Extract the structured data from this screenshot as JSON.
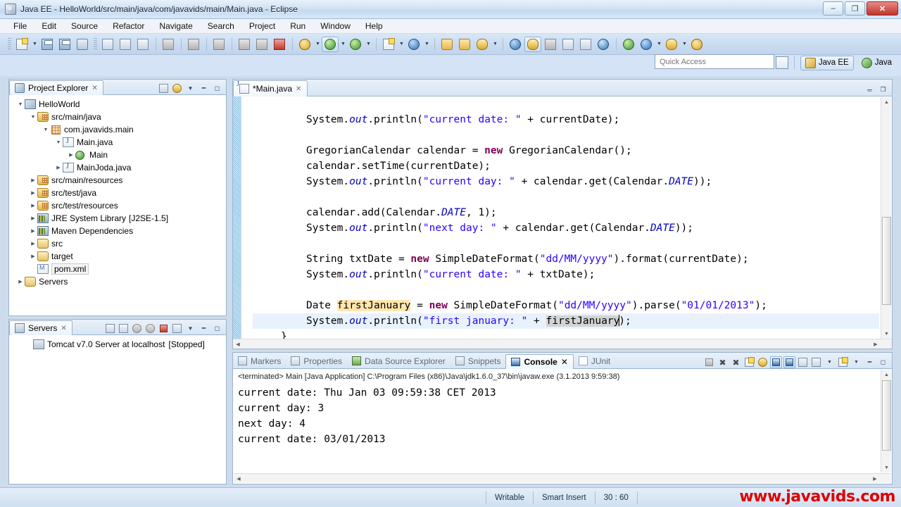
{
  "window": {
    "title": "Java EE - HelloWorld/src/main/java/com/javavids/main/Main.java - Eclipse",
    "minimize_label": "–",
    "maximize_label": "❐",
    "close_label": "✕"
  },
  "menu": {
    "items": [
      "File",
      "Edit",
      "Source",
      "Refactor",
      "Navigate",
      "Search",
      "Project",
      "Run",
      "Window",
      "Help"
    ]
  },
  "toolbar": {
    "icons": [
      "new-wizard-icon",
      "new-dropdown-icon",
      "save-icon",
      "save-all-icon",
      "print-icon",
      "toggle-breadcrumb-icon",
      "next-annotation-icon",
      "previous-annotation-icon",
      "undo-icon",
      "redo-icon",
      "back-icon",
      "step-into-icon",
      "step-over-icon",
      "terminate-icon",
      "debug-icon",
      "debug-dropdown-icon",
      "run-icon",
      "run-dropdown-icon",
      "run-external-icon",
      "run-external-dropdown-icon",
      "new-java-project-icon",
      "new-java-dropdown-icon",
      "search-icon",
      "search-dropdown-icon",
      "open-type-icon",
      "open-resource-icon",
      "new-annotation-icon",
      "new-annotation-dropdown-icon",
      "refresh-icon",
      "java-editor-icon",
      "skip-breakpoints-icon",
      "open-task-icon",
      "pilcrow-icon",
      "web-browser-icon",
      "run-server-icon",
      "import-icon",
      "import-dropdown-icon",
      "export-icon",
      "export-dropdown-icon",
      "more-icon"
    ]
  },
  "quick_access": {
    "placeholder": "Quick Access"
  },
  "perspectives": {
    "new_perspective_tooltip": "Open Perspective",
    "items": [
      {
        "label": "Java EE",
        "active": true
      },
      {
        "label": "Java",
        "active": false
      }
    ]
  },
  "project_explorer": {
    "tab_label": "Project Explorer",
    "close_label": "✕",
    "toolbar_icons": [
      "collapse-all-icon",
      "link-with-editor-icon",
      "view-menu-icon",
      "minimize-icon",
      "maximize-icon"
    ],
    "tree": [
      {
        "label": "HelloWorld",
        "indent": 0,
        "twisty": "open",
        "icon": "project-icon",
        "suffix": ""
      },
      {
        "label": "src/main/java",
        "indent": 1,
        "twisty": "open",
        "icon": "source-folder-icon",
        "suffix": ""
      },
      {
        "label": "com.javavids.main",
        "indent": 2,
        "twisty": "open",
        "icon": "package-icon",
        "suffix": ""
      },
      {
        "label": "Main.java",
        "indent": 3,
        "twisty": "open",
        "icon": "java-file-icon",
        "suffix": ""
      },
      {
        "label": "Main",
        "indent": 4,
        "twisty": "closed",
        "icon": "class-icon",
        "suffix": ""
      },
      {
        "label": "MainJoda.java",
        "indent": 3,
        "twisty": "closed",
        "icon": "java-file-icon",
        "suffix": ""
      },
      {
        "label": "src/main/resources",
        "indent": 1,
        "twisty": "closed",
        "icon": "source-folder-icon",
        "suffix": ""
      },
      {
        "label": "src/test/java",
        "indent": 1,
        "twisty": "closed",
        "icon": "source-folder-icon",
        "suffix": ""
      },
      {
        "label": "src/test/resources",
        "indent": 1,
        "twisty": "closed",
        "icon": "source-folder-icon",
        "suffix": ""
      },
      {
        "label": "JRE System Library",
        "indent": 1,
        "twisty": "closed",
        "icon": "library-icon",
        "suffix": "[J2SE-1.5]"
      },
      {
        "label": "Maven Dependencies",
        "indent": 1,
        "twisty": "closed",
        "icon": "library-icon",
        "suffix": ""
      },
      {
        "label": "src",
        "indent": 1,
        "twisty": "closed",
        "icon": "folder-icon",
        "suffix": ""
      },
      {
        "label": "target",
        "indent": 1,
        "twisty": "closed",
        "icon": "folder-icon",
        "suffix": ""
      },
      {
        "label": "pom.xml",
        "indent": 1,
        "twisty": "none",
        "icon": "pom-file-icon",
        "suffix": "",
        "selected": true
      },
      {
        "label": "Servers",
        "indent": 0,
        "twisty": "closed",
        "icon": "folder-icon",
        "suffix": ""
      }
    ]
  },
  "servers_view": {
    "tab_label": "Servers",
    "close_label": "✕",
    "toolbar_icons": [
      "collapse-all-icon",
      "debug-server-icon",
      "start-server-icon",
      "profile-server-icon",
      "stop-server-icon",
      "publish-icon",
      "view-menu-icon",
      "minimize-icon",
      "maximize-icon"
    ],
    "rows": [
      {
        "label": "Tomcat v7.0 Server at localhost",
        "status": "[Stopped]"
      }
    ]
  },
  "editor": {
    "tab_label": "*Main.java",
    "close_label": "✕",
    "minimize_label": "═",
    "maximize_label": "❐",
    "lines": [
      {
        "type": "blank"
      },
      {
        "segments": [
          {
            "t": "System."
          },
          {
            "t": "out",
            "c": "fld"
          },
          {
            "t": ".println("
          },
          {
            "t": "\"current date: \"",
            "c": "str"
          },
          {
            "t": " + currentDate);"
          }
        ]
      },
      {
        "type": "blank"
      },
      {
        "segments": [
          {
            "t": "GregorianCalendar calendar = "
          },
          {
            "t": "new",
            "c": "kw"
          },
          {
            "t": " GregorianCalendar();"
          }
        ]
      },
      {
        "segments": [
          {
            "t": "calendar.setTime(currentDate);"
          }
        ]
      },
      {
        "segments": [
          {
            "t": "System."
          },
          {
            "t": "out",
            "c": "fld"
          },
          {
            "t": ".println("
          },
          {
            "t": "\"current day: \"",
            "c": "str"
          },
          {
            "t": " + calendar.get(Calendar."
          },
          {
            "t": "DATE",
            "c": "fld"
          },
          {
            "t": "));"
          }
        ]
      },
      {
        "type": "blank"
      },
      {
        "segments": [
          {
            "t": "calendar.add(Calendar."
          },
          {
            "t": "DATE",
            "c": "fld"
          },
          {
            "t": ", 1);"
          }
        ]
      },
      {
        "segments": [
          {
            "t": "System."
          },
          {
            "t": "out",
            "c": "fld"
          },
          {
            "t": ".println("
          },
          {
            "t": "\"next day: \"",
            "c": "str"
          },
          {
            "t": " + calendar.get(Calendar."
          },
          {
            "t": "DATE",
            "c": "fld"
          },
          {
            "t": "));"
          }
        ]
      },
      {
        "type": "blank"
      },
      {
        "segments": [
          {
            "t": "String txtDate = "
          },
          {
            "t": "new",
            "c": "kw"
          },
          {
            "t": " SimpleDateFormat("
          },
          {
            "t": "\"dd/MM/yyyy\"",
            "c": "str"
          },
          {
            "t": ").format(currentDate);"
          }
        ]
      },
      {
        "segments": [
          {
            "t": "System."
          },
          {
            "t": "out",
            "c": "fld"
          },
          {
            "t": ".println("
          },
          {
            "t": "\"current date: \"",
            "c": "str"
          },
          {
            "t": " + txtDate);"
          }
        ]
      },
      {
        "type": "blank"
      },
      {
        "segments": [
          {
            "t": "Date "
          },
          {
            "t": "firstJanuary",
            "c": "occ-w"
          },
          {
            "t": " = "
          },
          {
            "t": "new",
            "c": "kw"
          },
          {
            "t": " SimpleDateFormat("
          },
          {
            "t": "\"dd/MM/yyyy\"",
            "c": "str"
          },
          {
            "t": ").parse("
          },
          {
            "t": "\"01/01/2013\"",
            "c": "str"
          },
          {
            "t": ");"
          }
        ]
      },
      {
        "current": true,
        "segments": [
          {
            "t": "System."
          },
          {
            "t": "out",
            "c": "fld"
          },
          {
            "t": ".println("
          },
          {
            "t": "\"first january: \"",
            "c": "str"
          },
          {
            "t": " + "
          },
          {
            "t": "firstJanuary",
            "c": "occ-r"
          },
          {
            "t": "|"
          },
          {
            "t": ");"
          }
        ]
      },
      {
        "segments": [
          {
            "t": "}"
          }
        ],
        "dedent": true
      }
    ]
  },
  "bottom_panel": {
    "tabs": [
      {
        "label": "Markers",
        "icon": "markers-icon",
        "active": false
      },
      {
        "label": "Properties",
        "icon": "properties-icon",
        "active": false
      },
      {
        "label": "Data Source Explorer",
        "icon": "data-source-icon",
        "active": false
      },
      {
        "label": "Snippets",
        "icon": "snippets-icon",
        "active": false
      },
      {
        "label": "Console",
        "icon": "console-icon",
        "active": true
      },
      {
        "label": "JUnit",
        "icon": "junit-icon",
        "active": false
      }
    ],
    "close_label": "✕",
    "toolbar_icons": [
      "terminate-icon",
      "remove-launch-icon",
      "remove-all-launches-icon",
      "clear-console-icon",
      "scroll-lock-icon",
      "show-console-on-output-icon",
      "pin-console-icon",
      "open-console-icon",
      "display-selected-console-icon",
      "display-selected-dropdown-icon",
      "new-console-view-icon",
      "new-console-dropdown-icon",
      "minimize-icon",
      "maximize-icon"
    ],
    "console": {
      "header": "<terminated> Main [Java Application] C:\\Program Files (x86)\\Java\\jdk1.6.0_37\\bin\\javaw.exe (3.1.2013 9:59:38)",
      "output": [
        "current date: Thu Jan 03 09:59:38 CET 2013",
        "current day: 3",
        "next day: 4",
        "current date: 03/01/2013"
      ]
    }
  },
  "statusbar": {
    "writable": "Writable",
    "insert_mode": "Smart Insert",
    "position": "30 : 60",
    "watermark": "www.javavids.com"
  }
}
